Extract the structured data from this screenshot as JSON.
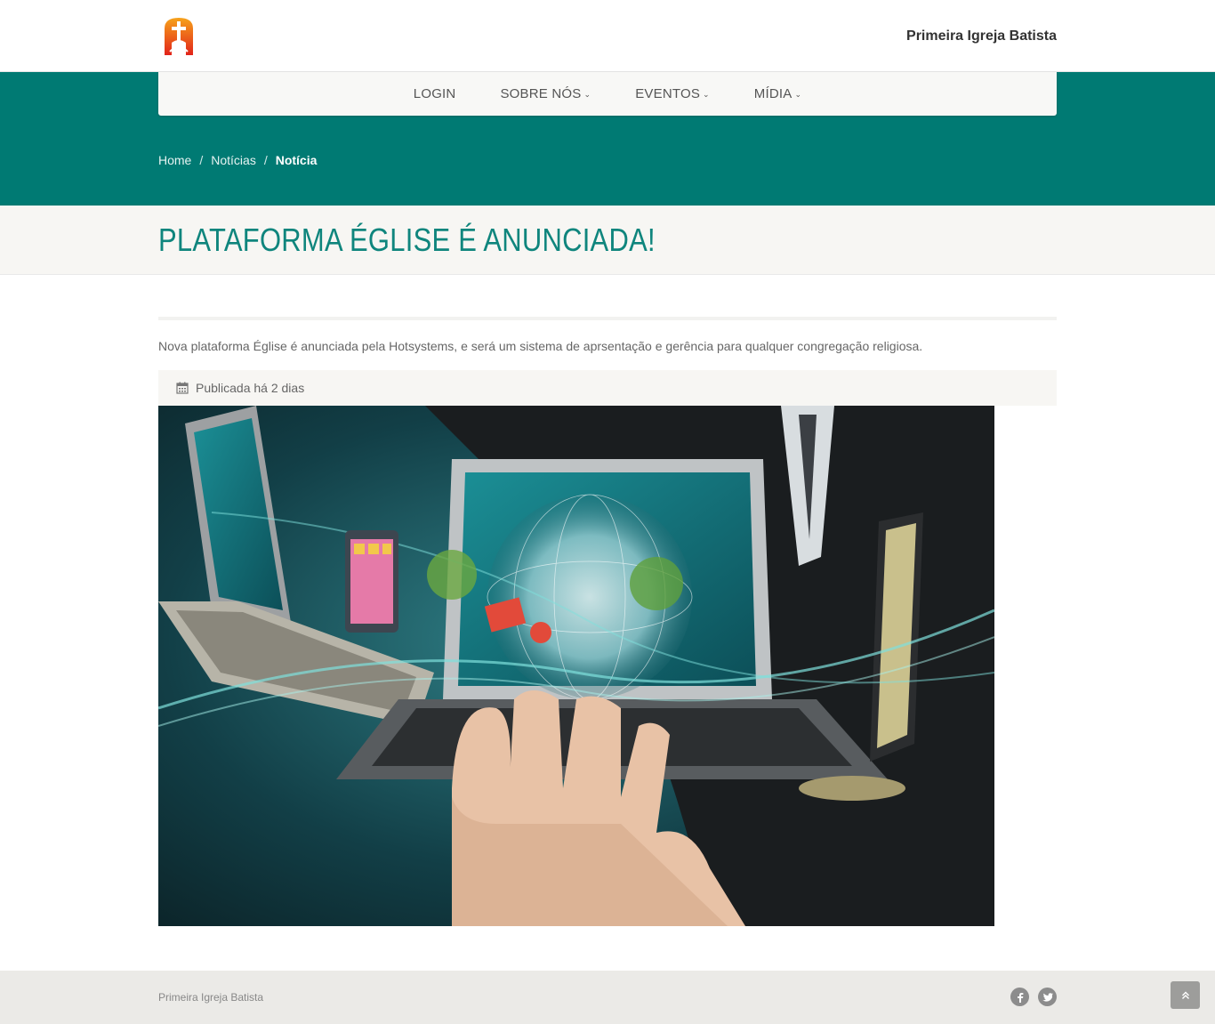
{
  "header": {
    "site_name": "Primeira Igreja Batista",
    "logo_icon": "church-cross-logo"
  },
  "nav": {
    "items": [
      {
        "label": "LOGIN",
        "has_dropdown": false
      },
      {
        "label": "SOBRE NÓS",
        "has_dropdown": true
      },
      {
        "label": "EVENTOS",
        "has_dropdown": true
      },
      {
        "label": "MÍDIA",
        "has_dropdown": true
      }
    ]
  },
  "breadcrumb": {
    "items": [
      "Home",
      "Notícias",
      "Notícia"
    ],
    "separator": "/"
  },
  "article": {
    "title": "PLATAFORMA ÉGLISE É ANUNCIADA!",
    "summary": "Nova plataforma Église é anunciada pela Hotsystems, e será um sistema de aprsentação e gerência para qualquer congregação religiosa.",
    "published": "Publicada há 2 dias",
    "image_icon": "technology-devices-photo"
  },
  "footer": {
    "text": "Primeira Igreja Batista",
    "social": [
      "facebook-icon",
      "twitter-icon"
    ]
  },
  "colors": {
    "primary": "#007a73",
    "title": "#0f857d",
    "light_bg": "#f7f6f3",
    "footer_bg": "#ebeae7"
  }
}
